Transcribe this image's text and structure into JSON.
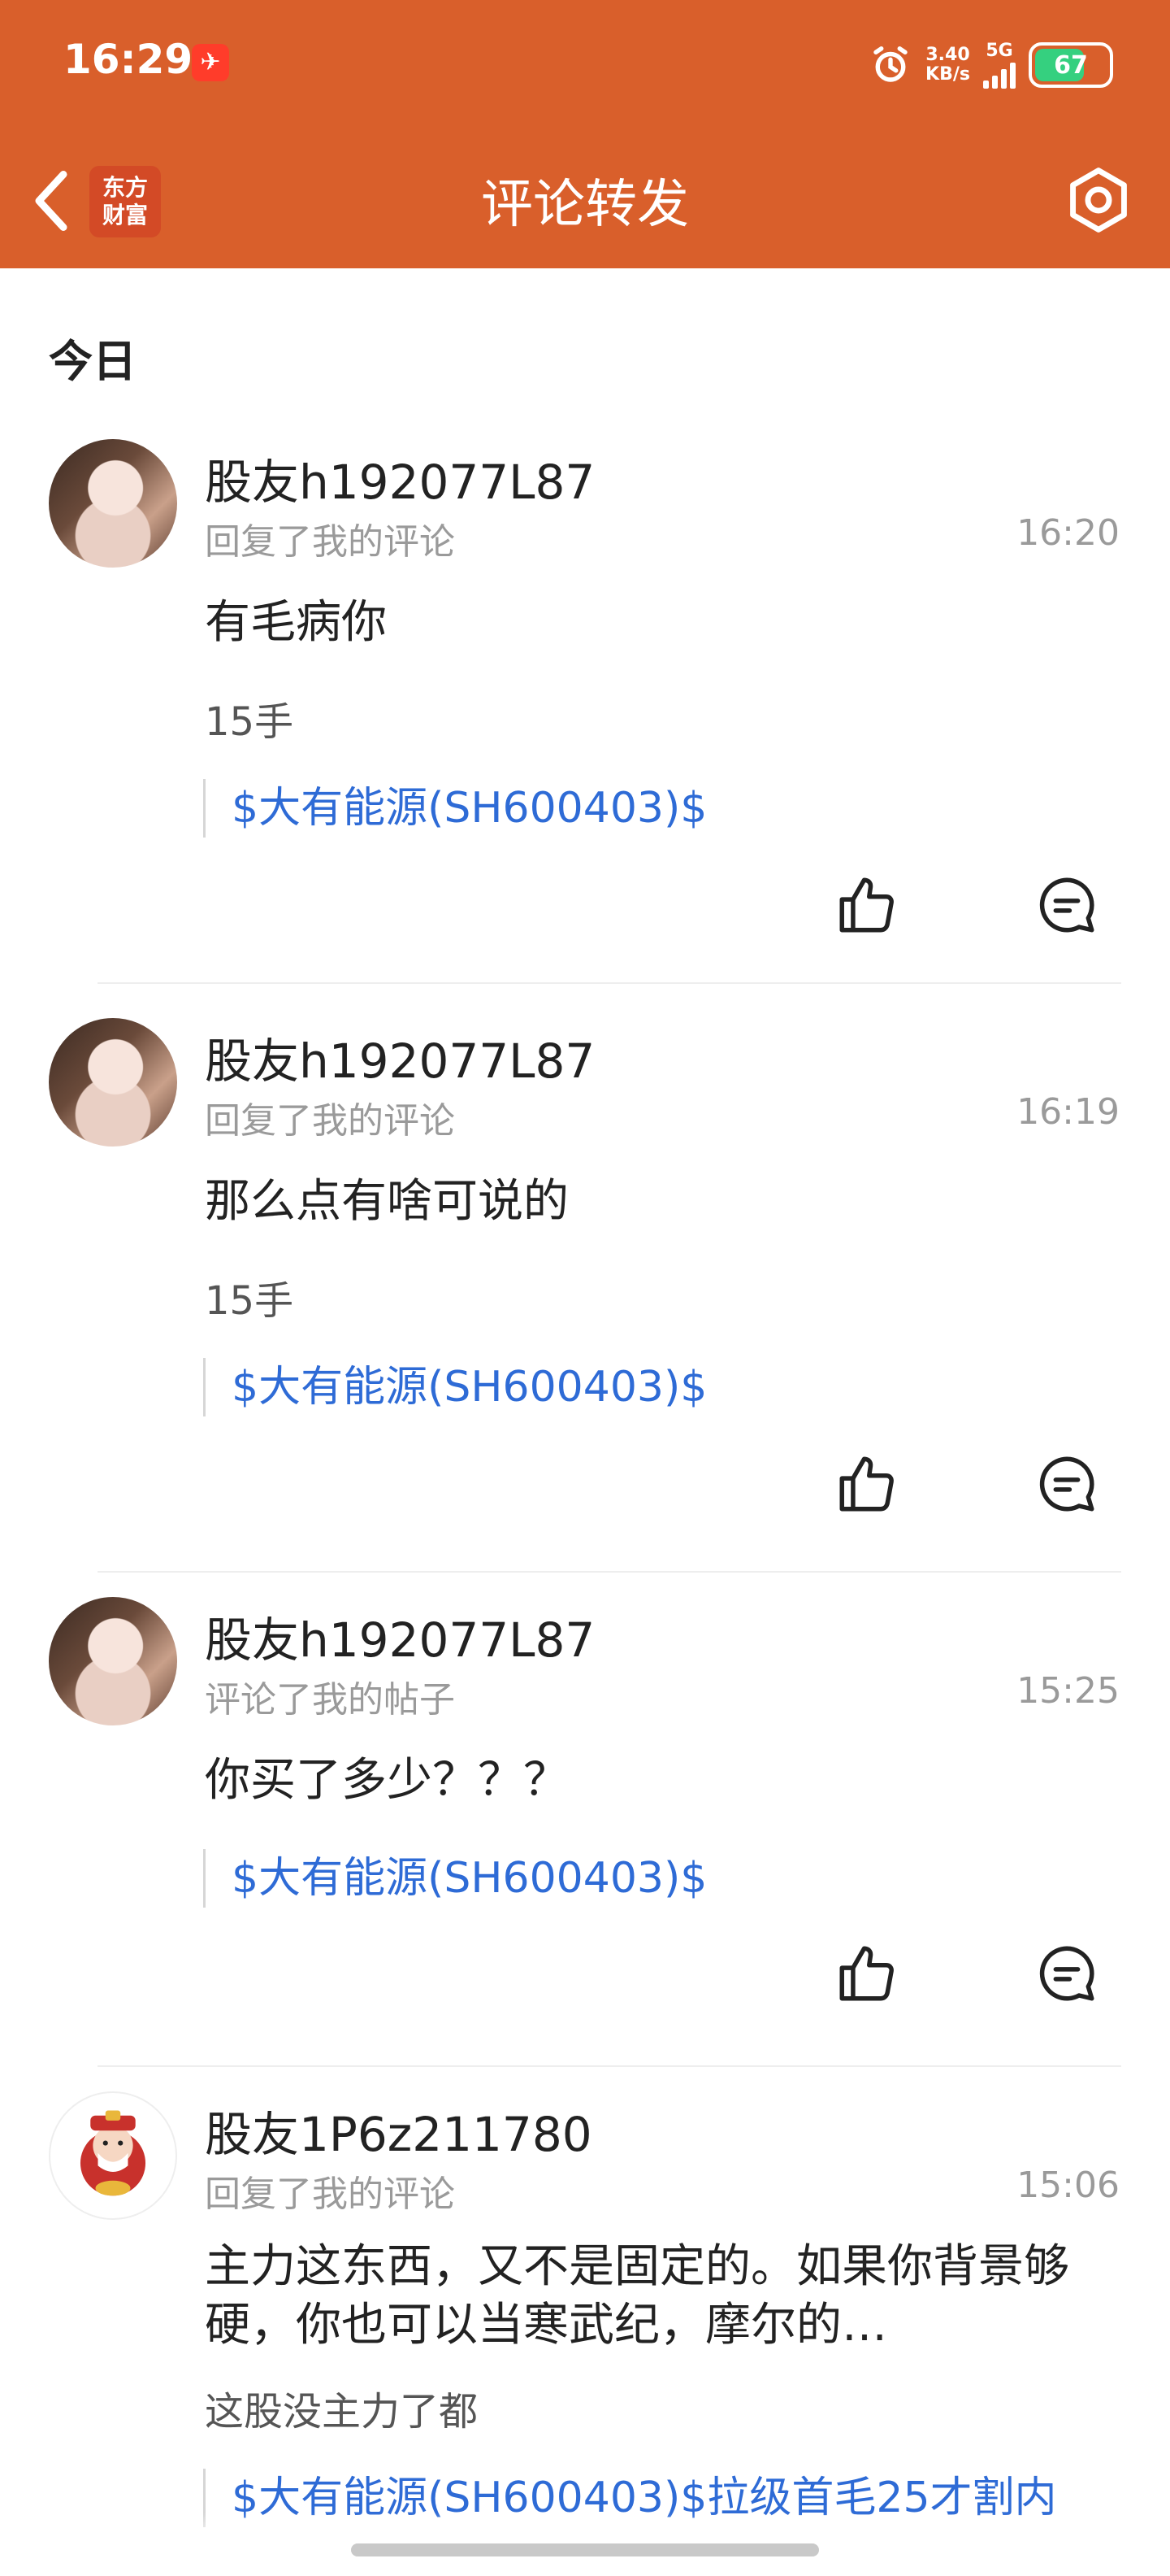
{
  "status_bar": {
    "time": "16:29",
    "net_speed_value": "3.40",
    "net_speed_unit": "KB/s",
    "network": "5G",
    "battery": "67"
  },
  "header": {
    "brand_line1": "东方",
    "brand_line2": "财富",
    "title": "评论转发"
  },
  "section": {
    "title": "今日"
  },
  "items": [
    {
      "user": "股友h192077L87",
      "action": "回复了我的评论",
      "time": "16:20",
      "content": "有毛病你",
      "quote": "15手",
      "stock": "$大有能源(SH600403)$"
    },
    {
      "user": "股友h192077L87",
      "action": "回复了我的评论",
      "time": "16:19",
      "content": "那么点有啥可说的",
      "quote": "15手",
      "stock": "$大有能源(SH600403)$"
    },
    {
      "user": "股友h192077L87",
      "action": "评论了我的帖子",
      "time": "15:25",
      "content": "你买了多少？？？",
      "stock": "$大有能源(SH600403)$"
    },
    {
      "user": "股友1P6z211780",
      "action": "回复了我的评论",
      "time": "15:06",
      "content": "主力这东西，又不是固定的。如果你背景够硬，你也可以当寒武纪，摩尔的…",
      "quote": "这股没主力了都",
      "stock": "$大有能源(SH600403)$拉级首毛25才割内"
    }
  ],
  "colors": {
    "brand_orange": "#D95F2B",
    "link_blue": "#2e6bd6",
    "muted_gray": "#9a9a9a"
  },
  "icons": [
    "back-arrow-icon",
    "gear-icon",
    "thumbs-up-icon",
    "comment-bubble-icon",
    "alarm-icon",
    "signal-icon",
    "battery-icon"
  ]
}
